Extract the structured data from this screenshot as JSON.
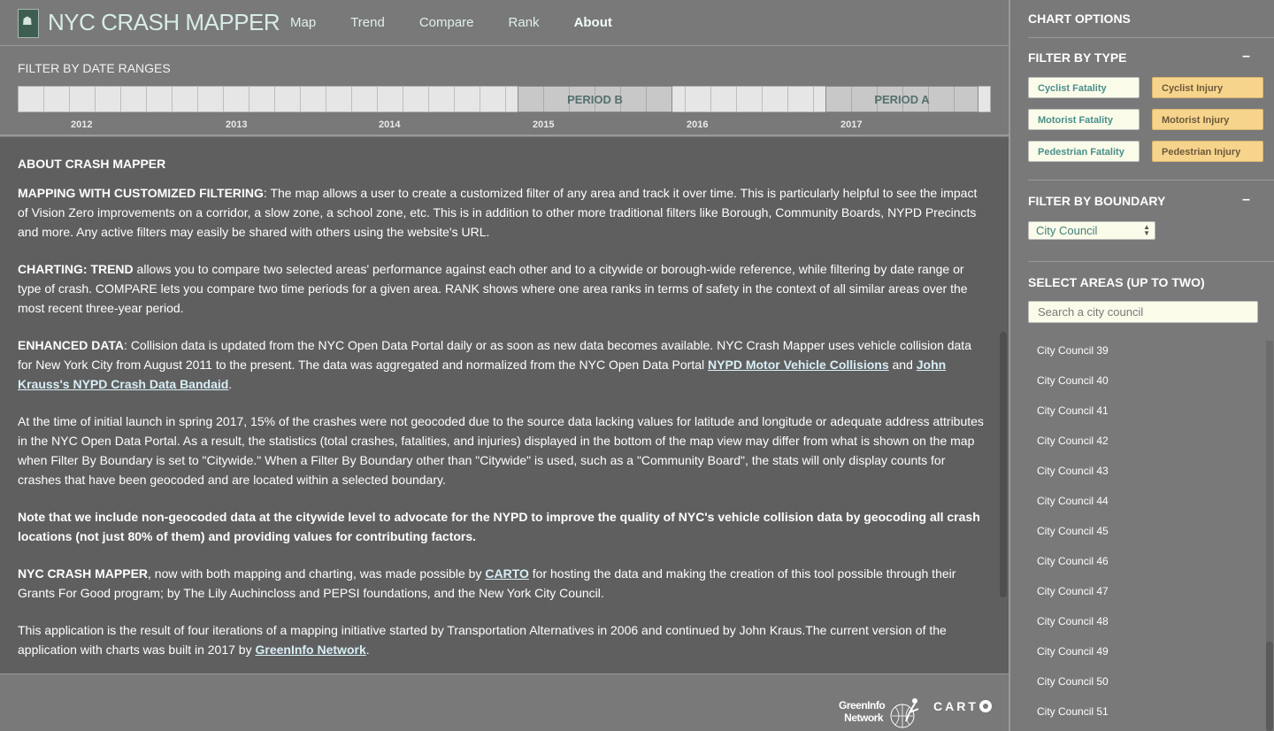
{
  "header": {
    "app_title": "NYC CRASH MAPPER",
    "logo_label": "CRASHMAPPER",
    "nav": [
      "Map",
      "Trend",
      "Compare",
      "Rank",
      "About"
    ],
    "active_nav": "About"
  },
  "date_filter": {
    "title": "FILTER BY DATE RANGES",
    "period_b_label": "PERIOD B",
    "period_a_label": "PERIOD A",
    "years": [
      "2012",
      "2013",
      "2014",
      "2015",
      "2016",
      "2017"
    ]
  },
  "about": {
    "title": "ABOUT CRASH MAPPER",
    "p1_lead": "MAPPING WITH CUSTOMIZED FILTERING",
    "p1_text": ": The map allows a user to create a customized filter of any area and track it over time. This is particularly helpful to see the impact of Vision Zero improvements on a corridor, a slow zone, a school zone, etc. This is in addition to other more traditional filters like Borough, Community Boards, NYPD Precincts and more. Any active filters may easily be shared with others using the website's URL.",
    "p2_lead": "CHARTING: TREND",
    "p2_text": " allows you to compare two selected areas' performance against each other and to a citywide or borough-wide reference, while filtering by date range or type of crash. COMPARE lets you compare two time periods for a given area. RANK shows where one area ranks in terms of safety in the context of all similar areas over the most recent three-year period.",
    "p3_lead": "ENHANCED DATA",
    "p3_text": ": Collision data is updated from the NYC Open Data Portal daily or as soon as new data becomes available. NYC Crash Mapper uses vehicle collision data for New York City from August 2011 to the present. The data was aggregated and normalized from the NYC Open Data Portal ",
    "p3_link1": "NYPD Motor Vehicle Collisions",
    "p3_and": " and ",
    "p3_link2": "John Krauss's NYPD Crash Data Bandaid",
    "p3_end": ".",
    "p4_text": "At the time of initial launch in spring 2017, 15% of the crashes were not geocoded due to the source data lacking values for latitude and longitude or adequate address attributes in the NYC Open Data Portal. As a result, the statistics (total crashes, fatalities, and injuries) displayed in the bottom of the map view may differ from what is shown on the map when Filter By Boundary is set to \"Citywide.\" When a Filter By Boundary other than \"Citywide\" is used, such as a \"Community Board\", the stats will only display counts for crashes that have been geocoded and are located within a selected boundary.",
    "p5_text": "Note that we include non-geocoded data at the citywide level to advocate for the NYPD to improve the quality of NYC's vehicle collision data by geocoding all crash locations (not just 80% of them) and providing values for contributing factors.",
    "p6_lead": "NYC CRASH MAPPER",
    "p6_text": ", now with both mapping and charting, was made possible by ",
    "p6_link": "CARTO",
    "p6_end": " for hosting the data and making the creation of this tool possible through their Grants For Good program; by The Lily Auchincloss and PEPSI foundations, and the New York City Council.",
    "p7_text": "This application is the result of four iterations of a mapping initiative started by Transportation Alternatives in 2006 and continued by John Kraus.The current version of the application with charts was built in 2017 by ",
    "p7_link": "GreenInfo Network",
    "p7_end": "."
  },
  "footer": {
    "greeninfo_line1": "GreenInfo",
    "greeninfo_line2": "Network",
    "carto": "CART"
  },
  "sidebar": {
    "title": "CHART OPTIONS",
    "filter_type_title": "FILTER BY TYPE",
    "collapse_symbol": "–",
    "type_buttons": {
      "cyclist_fatality": "Cyclist Fatality",
      "cyclist_injury": "Cyclist Injury",
      "motorist_fatality": "Motorist Fatality",
      "motorist_injury": "Motorist Injury",
      "pedestrian_fatality": "Pedestrian Fatality",
      "pedestrian_injury": "Pedestrian Injury"
    },
    "filter_boundary_title": "FILTER BY BOUNDARY",
    "boundary_value": "City Council",
    "select_areas_title": "SELECT AREAS (UP TO TWO)",
    "search_placeholder": "Search a city council",
    "areas": [
      "City Council 39",
      "City Council 40",
      "City Council 41",
      "City Council 42",
      "City Council 43",
      "City Council 44",
      "City Council 45",
      "City Council 46",
      "City Council 47",
      "City Council 48",
      "City Council 49",
      "City Council 50",
      "City Council 51"
    ]
  }
}
